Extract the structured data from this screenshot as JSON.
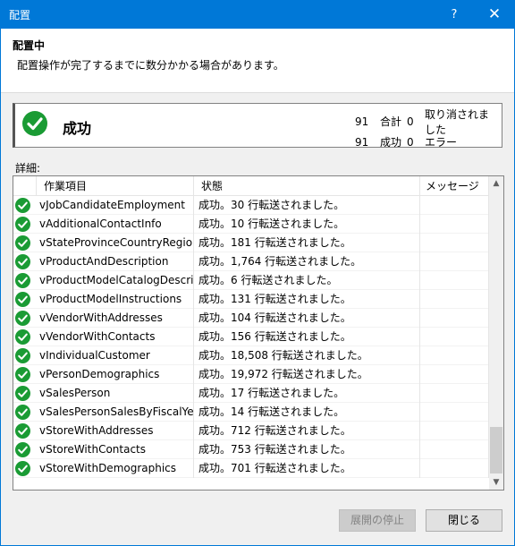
{
  "window": {
    "title": "配置",
    "help": "?",
    "close": "✕"
  },
  "header": {
    "title": "配置中",
    "subtitle": "配置操作が完了するまでに数分かかる場合があります。"
  },
  "summary": {
    "status": "成功",
    "stat1": {
      "n1": "91",
      "label1": "合計",
      "n2": "0",
      "label2": "取り消されました"
    },
    "stat2": {
      "n1": "91",
      "label1": "成功",
      "n2": "0",
      "label2": "エラー"
    }
  },
  "details_label": "詳細:",
  "grid": {
    "columns": [
      "作業項目",
      "状態",
      "メッセージ"
    ],
    "rows": [
      {
        "name": "vJobCandidateEmployment",
        "status": "成功。30 行転送されました。",
        "message": ""
      },
      {
        "name": "vAdditionalContactInfo",
        "status": "成功。10 行転送されました。",
        "message": ""
      },
      {
        "name": "vStateProvinceCountryRegion",
        "status": "成功。181 行転送されました。",
        "message": ""
      },
      {
        "name": "vProductAndDescription",
        "status": "成功。1,764 行転送されました。",
        "message": ""
      },
      {
        "name": "vProductModelCatalogDescri...",
        "status": "成功。6 行転送されました。",
        "message": ""
      },
      {
        "name": "vProductModelInstructions",
        "status": "成功。131 行転送されました。",
        "message": ""
      },
      {
        "name": "vVendorWithAddresses",
        "status": "成功。104 行転送されました。",
        "message": ""
      },
      {
        "name": "vVendorWithContacts",
        "status": "成功。156 行転送されました。",
        "message": ""
      },
      {
        "name": "vIndividualCustomer",
        "status": "成功。18,508 行転送されました。",
        "message": ""
      },
      {
        "name": "vPersonDemographics",
        "status": "成功。19,972 行転送されました。",
        "message": ""
      },
      {
        "name": "vSalesPerson",
        "status": "成功。17 行転送されました。",
        "message": ""
      },
      {
        "name": "vSalesPersonSalesByFiscalYears",
        "status": "成功。14 行転送されました。",
        "message": ""
      },
      {
        "name": "vStoreWithAddresses",
        "status": "成功。712 行転送されました。",
        "message": ""
      },
      {
        "name": "vStoreWithContacts",
        "status": "成功。753 行転送されました。",
        "message": ""
      },
      {
        "name": "vStoreWithDemographics",
        "status": "成功。701 行転送されました。",
        "message": ""
      }
    ]
  },
  "buttons": {
    "stop": "展開の停止",
    "close": "閉じる"
  },
  "colors": {
    "titlebar": "#0078d7",
    "success": "#1a9b34"
  }
}
